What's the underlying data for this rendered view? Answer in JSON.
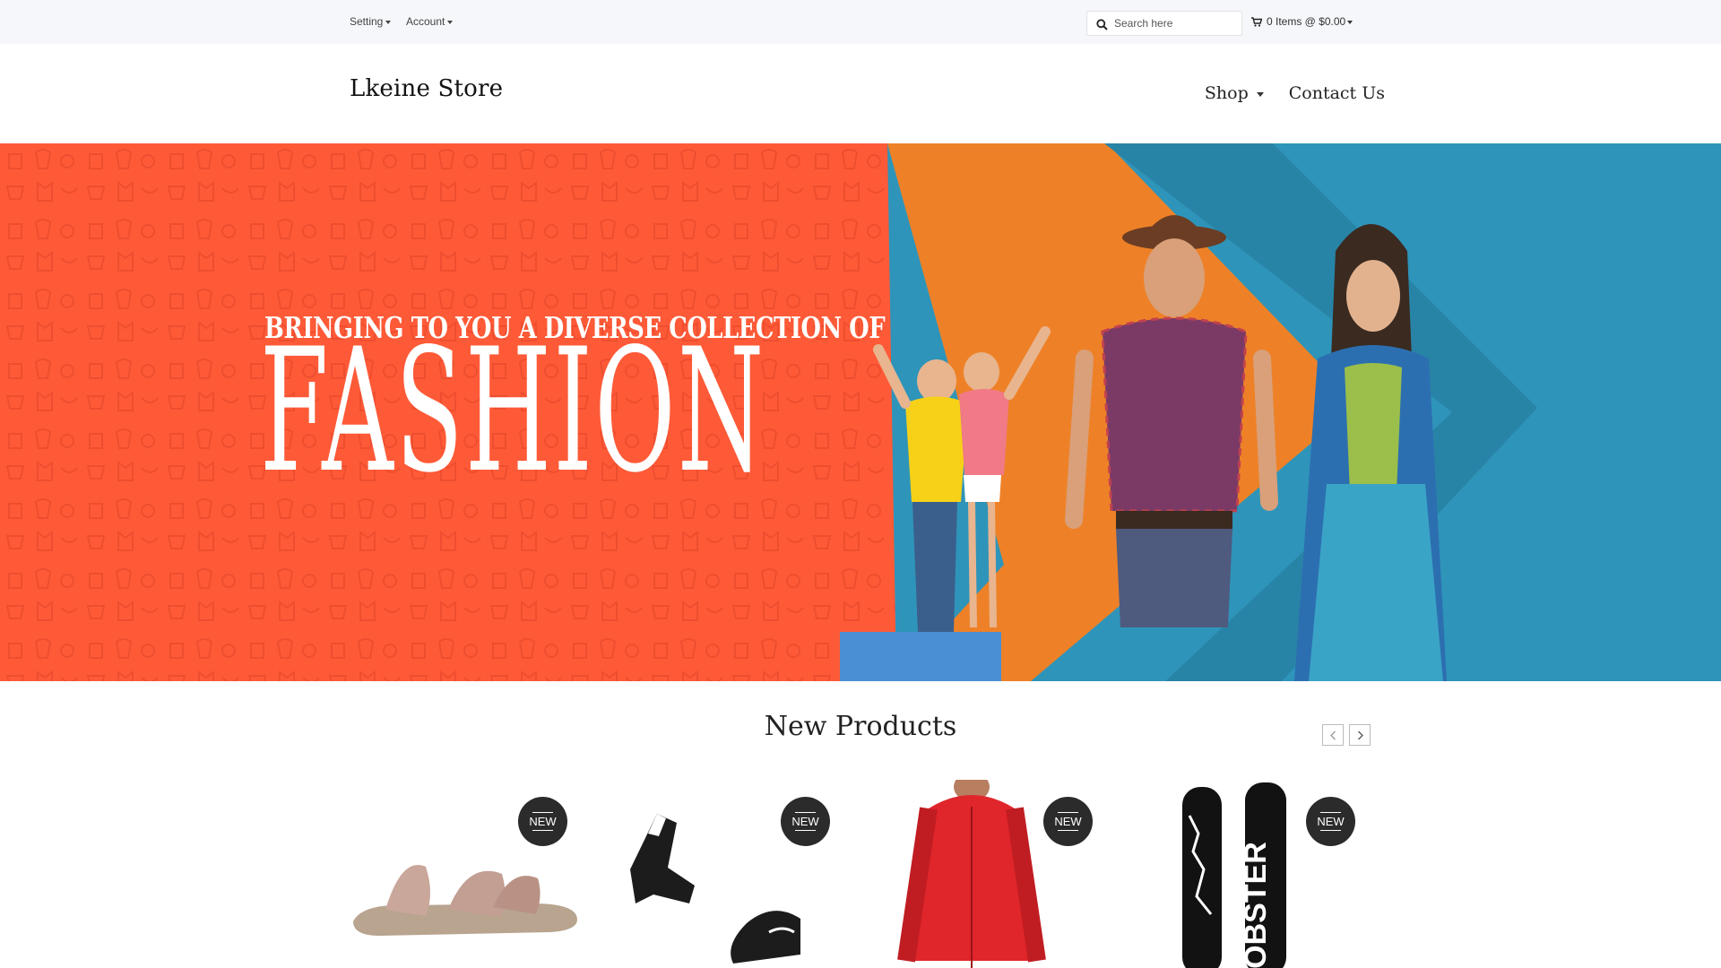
{
  "topbar": {
    "setting_label": "Setting",
    "account_label": "Account",
    "search_placeholder": "Search here",
    "cart_label": "0 Items @ $0.00"
  },
  "header": {
    "logo": "Lkeine Store",
    "nav": [
      {
        "label": "Shop",
        "has_dropdown": true
      },
      {
        "label": "Contact Us",
        "has_dropdown": false
      }
    ]
  },
  "hero": {
    "line1": "BRINGING TO YOU A DIVERSE COLLECTION OF",
    "line2": "FASHION",
    "colors": {
      "left": "#fe5a37",
      "middle": "#ee8127",
      "right": "#2f94b9"
    }
  },
  "new_products": {
    "title": "New Products",
    "prev_icon": "chevron-left-icon",
    "next_icon": "chevron-right-icon",
    "items": [
      {
        "name": "sandal",
        "badge": "NEW"
      },
      {
        "name": "ski-bindings",
        "badge": "NEW"
      },
      {
        "name": "red-jacket",
        "badge": "NEW"
      },
      {
        "name": "snowboards",
        "badge": "NEW"
      }
    ]
  }
}
